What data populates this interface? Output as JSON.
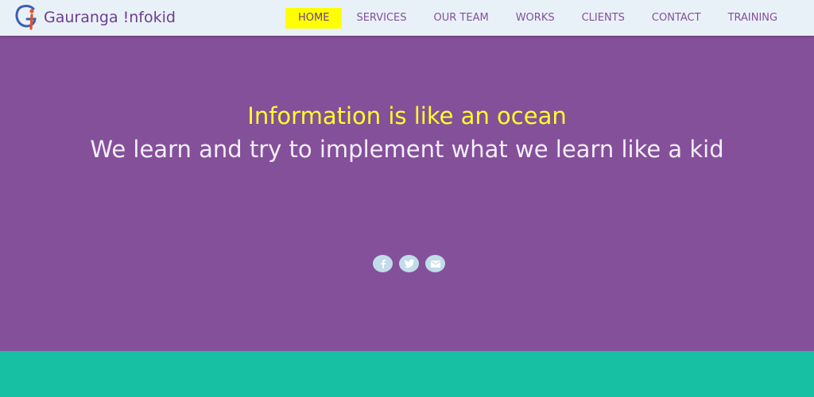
{
  "brand": {
    "name": "Gauranga !nfokid",
    "logo_icon": "gi-monogram-icon"
  },
  "nav": {
    "items": [
      {
        "label": "HOME",
        "active": true
      },
      {
        "label": "SERVICES",
        "active": false
      },
      {
        "label": "OUR TEAM",
        "active": false
      },
      {
        "label": "WORKS",
        "active": false
      },
      {
        "label": "CLIENTS",
        "active": false
      },
      {
        "label": "CONTACT",
        "active": false
      },
      {
        "label": "TRAINING",
        "active": false
      }
    ]
  },
  "hero": {
    "tagline": "Information is like an ocean",
    "headline": "We learn and try to implement what we learn like a kid",
    "social": [
      {
        "icon": "facebook-icon"
      },
      {
        "icon": "twitter-icon"
      },
      {
        "icon": "mail-icon"
      }
    ]
  },
  "colors": {
    "navbar_bg": "#e9f1f8",
    "nav_text": "#84509a",
    "active_nav_bg": "#ffff00",
    "hero_bg": "#84509a",
    "tagline": "#ffff2b",
    "headline": "#f4eefa",
    "social_bg": "#c2dcea",
    "bottom_band": "#17bfa3"
  }
}
